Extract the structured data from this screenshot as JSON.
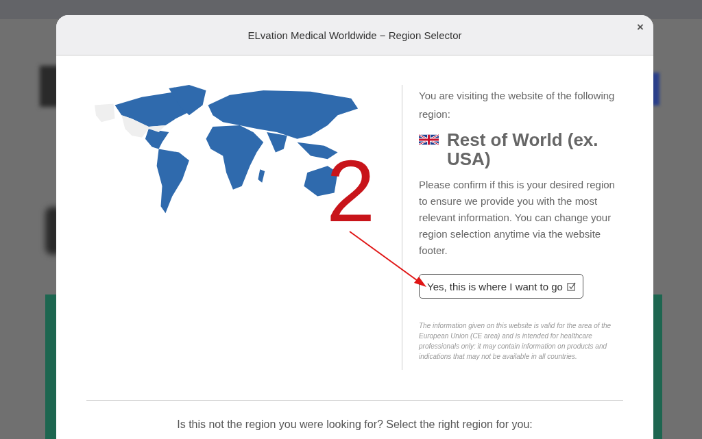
{
  "modal": {
    "title": "ELvation Medical Worldwide − Region Selector",
    "close": "×",
    "intro": "You are visiting the website of the following region:",
    "region": "Rest of World (ex. USA)",
    "message": "Please confirm if this is your desired region to ensure we provide you with the most relevant information. You can change your region selection anytime via the website footer.",
    "confirm_button": "Yes, this is where I want to go",
    "disclaimer": "The information given on this website is valid for the area of the European Union (CE area) and is intended for healthcare professionals only: it may contain information on products and indications that may not be available in all countries.",
    "other_regions_prompt": "Is this not the region you were looking for? Select the right region for you:"
  },
  "annotation": {
    "label": "2"
  }
}
